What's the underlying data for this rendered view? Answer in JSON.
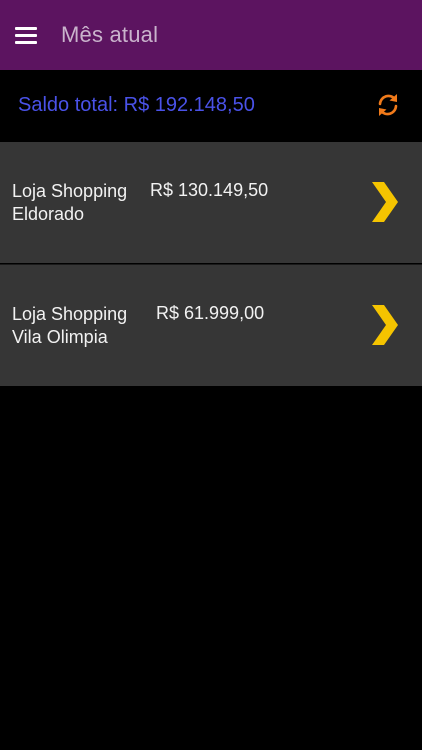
{
  "appbar": {
    "title": "Mês atual",
    "menu_icon": "hamburger-menu-icon",
    "background": "#5c1460"
  },
  "balance": {
    "label": "Saldo total: R$ 192.148,50",
    "color": "#4a52e8",
    "refresh_icon": "refresh-icon",
    "refresh_color": "#f07a1a"
  },
  "stores": [
    {
      "name": "Loja Shopping Eldorado",
      "value": "R$ 130.149,50",
      "icon": "chevron-right-icon"
    },
    {
      "name": "Loja Shopping Vila Olimpia",
      "value": "R$ 61.999,00",
      "icon": "chevron-right-icon"
    }
  ],
  "colors": {
    "item_background": "#363636",
    "chevron": "#f5c400",
    "text": "#f2f2f2"
  }
}
